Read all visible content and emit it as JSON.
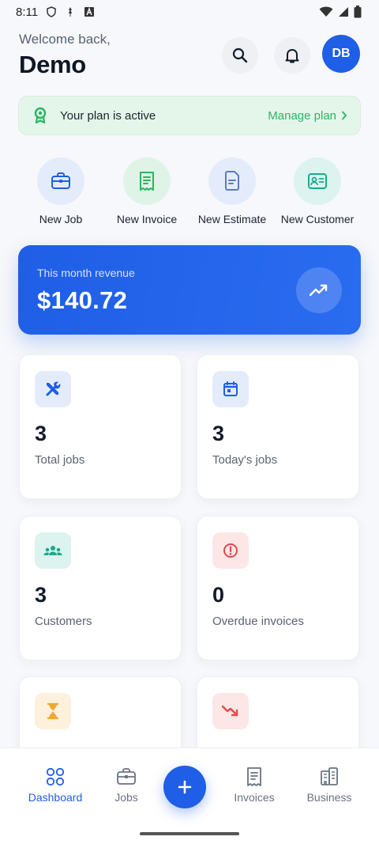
{
  "status_bar": {
    "time": "8:11"
  },
  "header": {
    "welcome": "Welcome back,",
    "name": "Demo",
    "avatar_initials": "DB"
  },
  "plan": {
    "text": "Your plan is active",
    "manage": "Manage plan"
  },
  "quick_actions": [
    {
      "label": "New Job",
      "icon": "briefcase-icon"
    },
    {
      "label": "New Invoice",
      "icon": "receipt-icon"
    },
    {
      "label": "New Estimate",
      "icon": "document-icon"
    },
    {
      "label": "New Customer",
      "icon": "contact-card-icon"
    }
  ],
  "revenue": {
    "label": "This month revenue",
    "amount": "$140.72"
  },
  "stats": [
    {
      "value": "3",
      "label": "Total jobs",
      "icon": "tools-icon"
    },
    {
      "value": "3",
      "label": "Today's jobs",
      "icon": "calendar-icon"
    },
    {
      "value": "3",
      "label": "Customers",
      "icon": "people-icon"
    },
    {
      "value": "0",
      "label": "Overdue invoices",
      "icon": "alert-circle-icon"
    },
    {
      "value": "",
      "label": "",
      "icon": "hourglass-icon"
    },
    {
      "value": "",
      "label": "",
      "icon": "trend-down-icon"
    }
  ],
  "nav": {
    "dashboard": "Dashboard",
    "jobs": "Jobs",
    "invoices": "Invoices",
    "business": "Business"
  },
  "colors": {
    "primary": "#1f5ee6",
    "success": "#2bb561",
    "danger": "#e5484d",
    "warning": "#f2a531",
    "teal": "#1aab8b"
  }
}
